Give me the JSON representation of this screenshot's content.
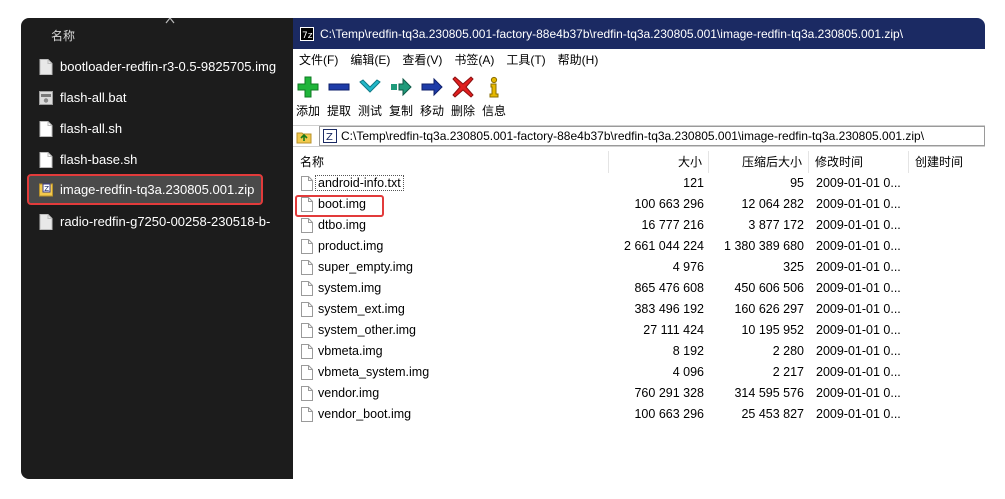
{
  "explorer": {
    "column_name": "名称",
    "items": [
      {
        "label": "bootloader-redfin-r3-0.5-9825705.img",
        "icon": "file-icon"
      },
      {
        "label": "flash-all.bat",
        "icon": "batch-file-icon"
      },
      {
        "label": "flash-all.sh",
        "icon": "file-icon"
      },
      {
        "label": "flash-base.sh",
        "icon": "file-icon"
      },
      {
        "label": "image-redfin-tq3a.230805.001.zip",
        "icon": "zip-archive-icon",
        "selected": true
      },
      {
        "label": "radio-redfin-g7250-00258-230518-b-",
        "icon": "file-icon"
      }
    ]
  },
  "window": {
    "title": "C:\\Temp\\redfin-tq3a.230805.001-factory-88e4b37b\\redfin-tq3a.230805.001\\image-redfin-tq3a.230805.001.zip\\",
    "menu": [
      "文件(F)",
      "编辑(E)",
      "查看(V)",
      "书签(A)",
      "工具(T)",
      "帮助(H)"
    ],
    "toolbar": [
      {
        "label": "添加",
        "icon": "plus-icon"
      },
      {
        "label": "提取",
        "icon": "minus-icon"
      },
      {
        "label": "测试",
        "icon": "check-arrow-icon"
      },
      {
        "label": "复制",
        "icon": "copy-arrow-icon"
      },
      {
        "label": "移动",
        "icon": "move-arrow-icon"
      },
      {
        "label": "删除",
        "icon": "delete-x-icon"
      },
      {
        "label": "信息",
        "icon": "info-icon"
      }
    ],
    "address": "C:\\Temp\\redfin-tq3a.230805.001-factory-88e4b37b\\redfin-tq3a.230805.001\\image-redfin-tq3a.230805.001.zip\\",
    "columns": {
      "name": "名称",
      "size": "大小",
      "packed": "压缩后大小",
      "modified": "修改时间",
      "created": "创建时间"
    },
    "files": [
      {
        "name": "android-info.txt",
        "size": "121",
        "packed": "95",
        "modified": "2009-01-01 0..."
      },
      {
        "name": "boot.img",
        "size": "100 663 296",
        "packed": "12 064 282",
        "modified": "2009-01-01 0..."
      },
      {
        "name": "dtbo.img",
        "size": "16 777 216",
        "packed": "3 877 172",
        "modified": "2009-01-01 0..."
      },
      {
        "name": "product.img",
        "size": "2 661 044 224",
        "packed": "1 380 389 680",
        "modified": "2009-01-01 0..."
      },
      {
        "name": "super_empty.img",
        "size": "4 976",
        "packed": "325",
        "modified": "2009-01-01 0..."
      },
      {
        "name": "system.img",
        "size": "865 476 608",
        "packed": "450 606 506",
        "modified": "2009-01-01 0..."
      },
      {
        "name": "system_ext.img",
        "size": "383 496 192",
        "packed": "160 626 297",
        "modified": "2009-01-01 0..."
      },
      {
        "name": "system_other.img",
        "size": "27 111 424",
        "packed": "10 195 952",
        "modified": "2009-01-01 0..."
      },
      {
        "name": "vbmeta.img",
        "size": "8 192",
        "packed": "2 280",
        "modified": "2009-01-01 0..."
      },
      {
        "name": "vbmeta_system.img",
        "size": "4 096",
        "packed": "2 217",
        "modified": "2009-01-01 0..."
      },
      {
        "name": "vendor.img",
        "size": "760 291 328",
        "packed": "314 595 576",
        "modified": "2009-01-01 0..."
      },
      {
        "name": "vendor_boot.img",
        "size": "100 663 296",
        "packed": "25 453 827",
        "modified": "2009-01-01 0..."
      }
    ]
  },
  "colors": {
    "title_bar": "#1b2a63",
    "explorer_bg": "#1c1c1c",
    "highlight": "#e23b3b"
  }
}
